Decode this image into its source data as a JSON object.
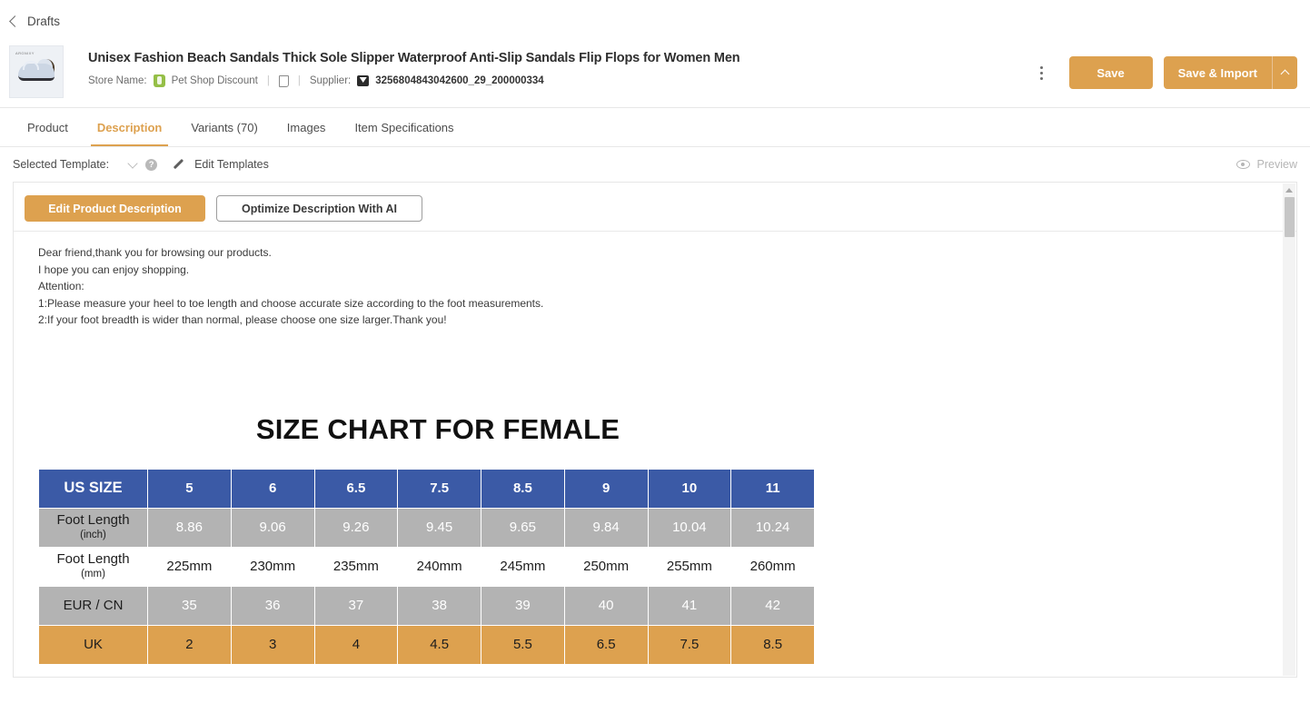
{
  "topbar": {
    "back_label": "Drafts",
    "back_icon": "chevron-left-icon"
  },
  "product": {
    "title": "Unisex Fashion Beach Sandals Thick Sole Slipper Waterproof Anti-Slip Sandals Flip Flops for Women Men",
    "thumb_brand": "ARGNIXY",
    "store_name_label": "Store Name:",
    "store_name": "Pet Shop Discount",
    "separator": "|",
    "supplier_label": "Supplier:",
    "supplier_id": "3256804843042600_29_200000334",
    "store_icon": "shopify-icon",
    "note_icon": "note-icon",
    "supplier_icon": "supplier-icon"
  },
  "header_actions": {
    "kebab_icon": "more-vertical-icon",
    "save_label": "Save",
    "save_import_label": "Save & Import",
    "caret_icon": "caret-up-icon"
  },
  "tabs": [
    {
      "label": "Product",
      "active": false
    },
    {
      "label": "Description",
      "active": true
    },
    {
      "label": "Variants (70)",
      "active": false
    },
    {
      "label": "Images",
      "active": false
    },
    {
      "label": "Item Specifications",
      "active": false
    }
  ],
  "template_row": {
    "label": "Selected Template:",
    "selected_value": "",
    "chevron_icon": "chevron-down-icon",
    "help_icon": "help-circle-icon",
    "help_glyph": "?",
    "pencil_icon": "pencil-icon",
    "edit_templates_label": "Edit Templates",
    "preview_label": "Preview",
    "preview_icon": "eye-icon"
  },
  "card": {
    "edit_description_label": "Edit Product Description",
    "optimize_ai_label": "Optimize Description With AI"
  },
  "description_lines": [
    "Dear friend,thank you for browsing our products.",
    "I hope you can enjoy shopping.",
    "Attention:",
    "1:Please measure your heel to toe length and choose accurate size according to the foot measurements.",
    "2:If your foot breadth is wider than normal, please choose one size larger.Thank you!"
  ],
  "chart_data": {
    "type": "table",
    "title": "SIZE CHART FOR FEMALE",
    "categories": [
      "5",
      "6",
      "6.5",
      "7.5",
      "8.5",
      "9",
      "10",
      "11"
    ],
    "row_labels": [
      "US SIZE",
      "Foot Length",
      "Foot Length",
      "EUR / CN",
      "UK"
    ],
    "rows": [
      {
        "label": "US SIZE",
        "sub": "",
        "style": "head",
        "values": [
          "5",
          "6",
          "6.5",
          "7.5",
          "8.5",
          "9",
          "10",
          "11"
        ]
      },
      {
        "label": "Foot Length",
        "sub": "(inch)",
        "style": "grey",
        "values": [
          "8.86",
          "9.06",
          "9.26",
          "9.45",
          "9.65",
          "9.84",
          "10.04",
          "10.24"
        ]
      },
      {
        "label": "Foot Length",
        "sub": "(mm)",
        "style": "white",
        "values": [
          "225mm",
          "230mm",
          "235mm",
          "240mm",
          "245mm",
          "250mm",
          "255mm",
          "260mm"
        ]
      },
      {
        "label": "EUR / CN",
        "sub": "",
        "style": "grey",
        "values": [
          "35",
          "36",
          "37",
          "38",
          "39",
          "40",
          "41",
          "42"
        ]
      },
      {
        "label": "UK",
        "sub": "",
        "style": "orange",
        "values": [
          "2",
          "3",
          "4",
          "4.5",
          "5.5",
          "6.5",
          "7.5",
          "8.5"
        ]
      }
    ],
    "colors": {
      "header": "#3b5aa6",
      "grey": "#b3b3b3",
      "white": "#ffffff",
      "orange": "#dda14f"
    }
  },
  "colors": {
    "accent": "#dda14f",
    "header_blue": "#3b5aa6",
    "text": "#3c3c3c"
  }
}
